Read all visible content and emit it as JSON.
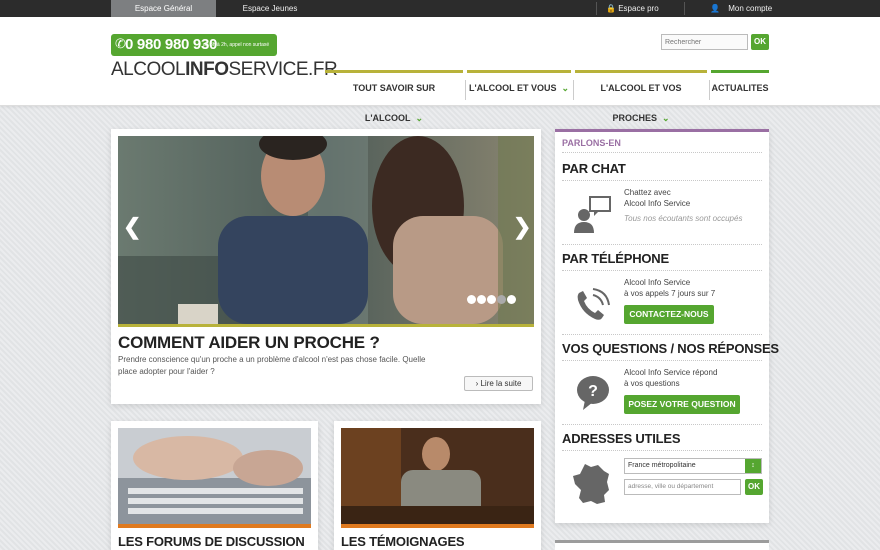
{
  "topbar": {
    "tab_general": "Espace Général",
    "tab_jeunes": "Espace Jeunes",
    "espace_pro": "Espace pro",
    "mon_compte": "Mon compte"
  },
  "header": {
    "phone_number": "0 980 980 930",
    "phone_hours": "de 8h à 2h, appel non surtaxé",
    "logo_part1": "ALCOOL",
    "logo_part2": "INFO",
    "logo_part3": "SERVICE.FR",
    "search_placeholder": "Rechercher",
    "search_ok": "OK"
  },
  "nav": {
    "items": [
      {
        "label": "TOUT SAVOIR SUR L'ALCOOL"
      },
      {
        "label": "L'ALCOOL ET VOUS"
      },
      {
        "label": "L'ALCOOL ET VOS PROCHES"
      },
      {
        "label": "ACTUALITES"
      }
    ]
  },
  "slider": {
    "title": "COMMENT AIDER UN PROCHE ?",
    "text": "Prendre conscience qu'un proche a un problème d'alcool n'est pas chose facile. Quelle place adopter pour l'aider ?",
    "more": "Lire la suite",
    "active_dot": 4,
    "dot_count": 5
  },
  "cards": [
    {
      "title": "LES FORUMS DE DISCUSSION"
    },
    {
      "title": "LES TÉMOIGNAGES"
    }
  ],
  "panel": {
    "header": "PARLONS-EN",
    "chat": {
      "title": "PAR CHAT",
      "line1": "Chattez avec",
      "line2": "Alcool Info Service",
      "note": "Tous nos écoutants sont occupés"
    },
    "phone": {
      "title": "PAR TÉLÉPHONE",
      "line1": "Alcool Info Service",
      "line2": "à vos appels 7 jours sur 7",
      "button": "CONTACTEZ-NOUS"
    },
    "questions": {
      "title": "VOS QUESTIONS / NOS RÉPONSES",
      "line1": "Alcool Info Service répond",
      "line2": "à vos questions",
      "button": "POSEZ VOTRE QUESTION"
    },
    "addresses": {
      "title": "ADRESSES UTILES",
      "select_value": "France métropolitaine",
      "input_placeholder": "adresse, ville ou département",
      "ok": "OK"
    }
  },
  "colors": {
    "green": "#55a630",
    "purple": "#9a6fa3",
    "olive": "#b8b23a",
    "orange": "#e07a1f"
  }
}
